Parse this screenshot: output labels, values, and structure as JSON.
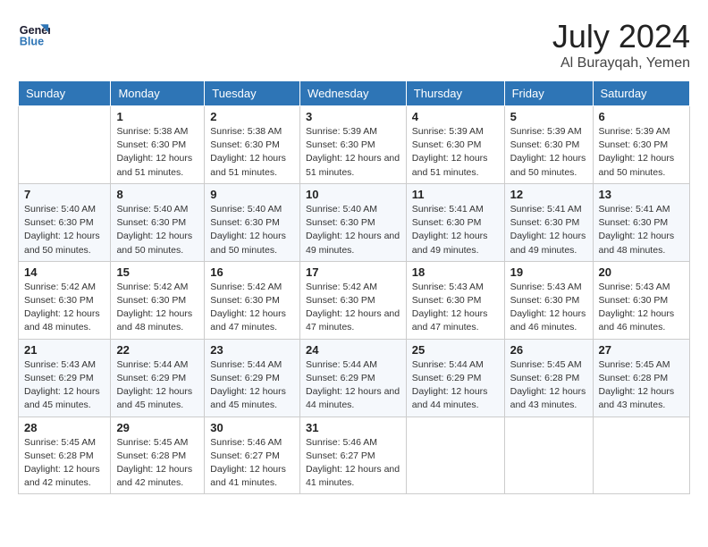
{
  "header": {
    "logo_line1": "General",
    "logo_line2": "Blue",
    "month": "July 2024",
    "location": "Al Burayqah, Yemen"
  },
  "weekdays": [
    "Sunday",
    "Monday",
    "Tuesday",
    "Wednesday",
    "Thursday",
    "Friday",
    "Saturday"
  ],
  "weeks": [
    [
      {
        "day": "",
        "info": ""
      },
      {
        "day": "1",
        "info": "Sunrise: 5:38 AM\nSunset: 6:30 PM\nDaylight: 12 hours and 51 minutes."
      },
      {
        "day": "2",
        "info": "Sunrise: 5:38 AM\nSunset: 6:30 PM\nDaylight: 12 hours and 51 minutes."
      },
      {
        "day": "3",
        "info": "Sunrise: 5:39 AM\nSunset: 6:30 PM\nDaylight: 12 hours and 51 minutes."
      },
      {
        "day": "4",
        "info": "Sunrise: 5:39 AM\nSunset: 6:30 PM\nDaylight: 12 hours and 51 minutes."
      },
      {
        "day": "5",
        "info": "Sunrise: 5:39 AM\nSunset: 6:30 PM\nDaylight: 12 hours and 50 minutes."
      },
      {
        "day": "6",
        "info": "Sunrise: 5:39 AM\nSunset: 6:30 PM\nDaylight: 12 hours and 50 minutes."
      }
    ],
    [
      {
        "day": "7",
        "info": "Sunrise: 5:40 AM\nSunset: 6:30 PM\nDaylight: 12 hours and 50 minutes."
      },
      {
        "day": "8",
        "info": "Sunrise: 5:40 AM\nSunset: 6:30 PM\nDaylight: 12 hours and 50 minutes."
      },
      {
        "day": "9",
        "info": "Sunrise: 5:40 AM\nSunset: 6:30 PM\nDaylight: 12 hours and 50 minutes."
      },
      {
        "day": "10",
        "info": "Sunrise: 5:40 AM\nSunset: 6:30 PM\nDaylight: 12 hours and 49 minutes."
      },
      {
        "day": "11",
        "info": "Sunrise: 5:41 AM\nSunset: 6:30 PM\nDaylight: 12 hours and 49 minutes."
      },
      {
        "day": "12",
        "info": "Sunrise: 5:41 AM\nSunset: 6:30 PM\nDaylight: 12 hours and 49 minutes."
      },
      {
        "day": "13",
        "info": "Sunrise: 5:41 AM\nSunset: 6:30 PM\nDaylight: 12 hours and 48 minutes."
      }
    ],
    [
      {
        "day": "14",
        "info": "Sunrise: 5:42 AM\nSunset: 6:30 PM\nDaylight: 12 hours and 48 minutes."
      },
      {
        "day": "15",
        "info": "Sunrise: 5:42 AM\nSunset: 6:30 PM\nDaylight: 12 hours and 48 minutes."
      },
      {
        "day": "16",
        "info": "Sunrise: 5:42 AM\nSunset: 6:30 PM\nDaylight: 12 hours and 47 minutes."
      },
      {
        "day": "17",
        "info": "Sunrise: 5:42 AM\nSunset: 6:30 PM\nDaylight: 12 hours and 47 minutes."
      },
      {
        "day": "18",
        "info": "Sunrise: 5:43 AM\nSunset: 6:30 PM\nDaylight: 12 hours and 47 minutes."
      },
      {
        "day": "19",
        "info": "Sunrise: 5:43 AM\nSunset: 6:30 PM\nDaylight: 12 hours and 46 minutes."
      },
      {
        "day": "20",
        "info": "Sunrise: 5:43 AM\nSunset: 6:30 PM\nDaylight: 12 hours and 46 minutes."
      }
    ],
    [
      {
        "day": "21",
        "info": "Sunrise: 5:43 AM\nSunset: 6:29 PM\nDaylight: 12 hours and 45 minutes."
      },
      {
        "day": "22",
        "info": "Sunrise: 5:44 AM\nSunset: 6:29 PM\nDaylight: 12 hours and 45 minutes."
      },
      {
        "day": "23",
        "info": "Sunrise: 5:44 AM\nSunset: 6:29 PM\nDaylight: 12 hours and 45 minutes."
      },
      {
        "day": "24",
        "info": "Sunrise: 5:44 AM\nSunset: 6:29 PM\nDaylight: 12 hours and 44 minutes."
      },
      {
        "day": "25",
        "info": "Sunrise: 5:44 AM\nSunset: 6:29 PM\nDaylight: 12 hours and 44 minutes."
      },
      {
        "day": "26",
        "info": "Sunrise: 5:45 AM\nSunset: 6:28 PM\nDaylight: 12 hours and 43 minutes."
      },
      {
        "day": "27",
        "info": "Sunrise: 5:45 AM\nSunset: 6:28 PM\nDaylight: 12 hours and 43 minutes."
      }
    ],
    [
      {
        "day": "28",
        "info": "Sunrise: 5:45 AM\nSunset: 6:28 PM\nDaylight: 12 hours and 42 minutes."
      },
      {
        "day": "29",
        "info": "Sunrise: 5:45 AM\nSunset: 6:28 PM\nDaylight: 12 hours and 42 minutes."
      },
      {
        "day": "30",
        "info": "Sunrise: 5:46 AM\nSunset: 6:27 PM\nDaylight: 12 hours and 41 minutes."
      },
      {
        "day": "31",
        "info": "Sunrise: 5:46 AM\nSunset: 6:27 PM\nDaylight: 12 hours and 41 minutes."
      },
      {
        "day": "",
        "info": ""
      },
      {
        "day": "",
        "info": ""
      },
      {
        "day": "",
        "info": ""
      }
    ]
  ]
}
